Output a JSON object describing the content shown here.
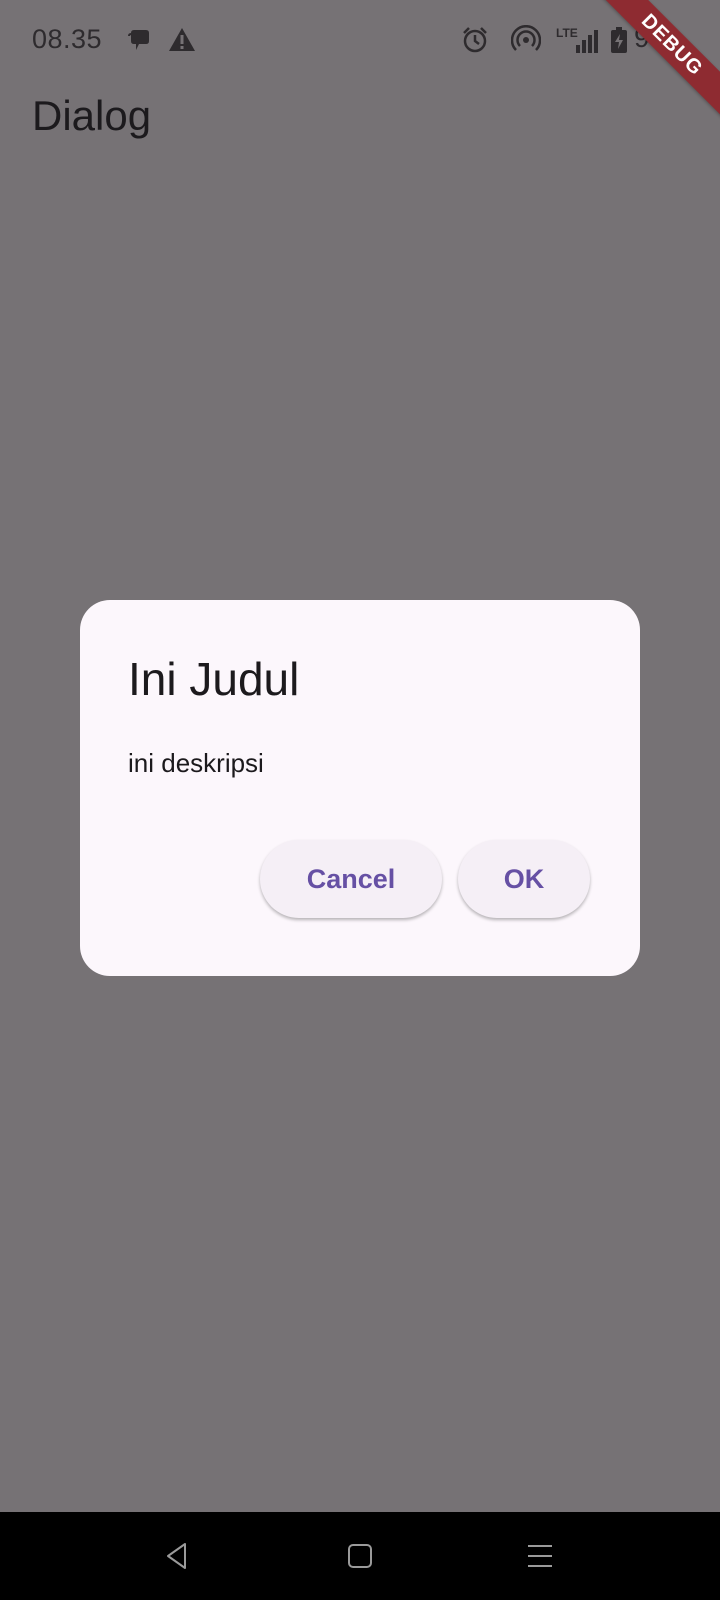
{
  "status_bar": {
    "time": "08.35",
    "network_label": "LTE",
    "battery_text": "9",
    "icons": [
      "chat-bubble-icon",
      "warning-icon",
      "alarm-icon",
      "hotspot-icon",
      "signal-icon",
      "battery-icon"
    ]
  },
  "app_bar": {
    "title": "Dialog"
  },
  "debug_banner": {
    "label": "DEBUG",
    "color": "#8e2b31"
  },
  "dialog": {
    "title": "Ini Judul",
    "content": "ini deskripsi",
    "cancel_label": "Cancel",
    "ok_label": "OK"
  },
  "nav_bar": {
    "icons": [
      "back-icon",
      "home-icon",
      "recents-icon"
    ]
  },
  "colors": {
    "scrim_background": "#767275",
    "dialog_surface": "#fcf7fc",
    "button_text": "#6650a4",
    "button_surface": "#f5eff6"
  }
}
